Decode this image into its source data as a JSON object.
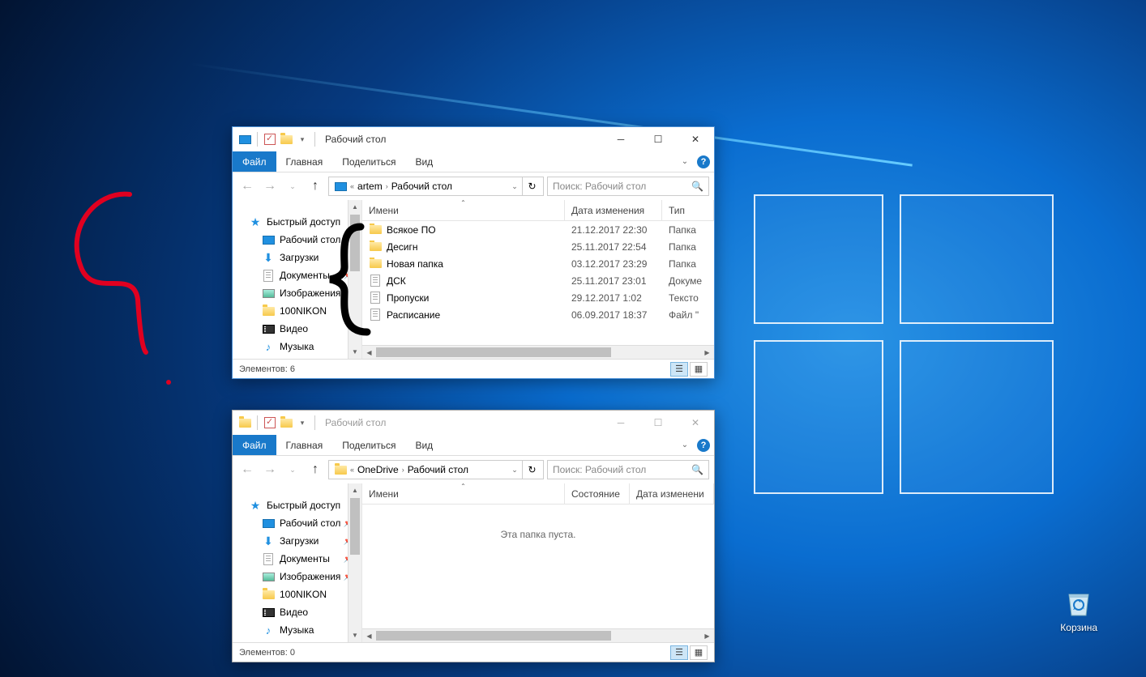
{
  "desktop": {
    "recycle_bin_label": "Корзина"
  },
  "win1": {
    "title": "Рабочий стол",
    "tabs": {
      "file": "Файл",
      "home": "Главная",
      "share": "Поделиться",
      "view": "Вид"
    },
    "breadcrumb": {
      "prefix": "«",
      "part1": "artem",
      "part2": "Рабочий стол"
    },
    "search_placeholder": "Поиск: Рабочий стол",
    "columns": {
      "name": "Имени",
      "date": "Дата изменения",
      "type": "Тип"
    },
    "sidebar": {
      "quick": "Быстрый доступ",
      "desktop": "Рабочий стол",
      "downloads": "Загрузки",
      "documents": "Документы",
      "pictures": "Изображения",
      "nikon": "100NIKON",
      "video": "Видео",
      "music": "Музыка"
    },
    "files": [
      {
        "name": "Всякое ПО",
        "date": "21.12.2017 22:30",
        "type": "Папка",
        "icon": "folder"
      },
      {
        "name": "Десигн",
        "date": "25.11.2017 22:54",
        "type": "Папка",
        "icon": "folder"
      },
      {
        "name": "Новая папка",
        "date": "03.12.2017 23:29",
        "type": "Папка",
        "icon": "folder"
      },
      {
        "name": "ДСК",
        "date": "25.11.2017 23:01",
        "type": "Докуме",
        "icon": "doc"
      },
      {
        "name": "Пропуски",
        "date": "29.12.2017 1:02",
        "type": "Тексто",
        "icon": "doc"
      },
      {
        "name": "Расписание",
        "date": "06.09.2017 18:37",
        "type": "Файл \"",
        "icon": "doc"
      }
    ],
    "status": "Элементов: 6"
  },
  "win2": {
    "title": "Рабочий стол",
    "tabs": {
      "file": "Файл",
      "home": "Главная",
      "share": "Поделиться",
      "view": "Вид"
    },
    "breadcrumb": {
      "prefix": "«",
      "part1": "OneDrive",
      "part2": "Рабочий стол"
    },
    "search_placeholder": "Поиск: Рабочий стол",
    "columns": {
      "name": "Имени",
      "state": "Состояние",
      "date": "Дата изменени"
    },
    "sidebar": {
      "quick": "Быстрый доступ",
      "desktop": "Рабочий стол",
      "downloads": "Загрузки",
      "documents": "Документы",
      "pictures": "Изображения",
      "nikon": "100NIKON",
      "video": "Видео",
      "music": "Музыка"
    },
    "empty_message": "Эта папка пуста.",
    "status": "Элементов: 0"
  }
}
